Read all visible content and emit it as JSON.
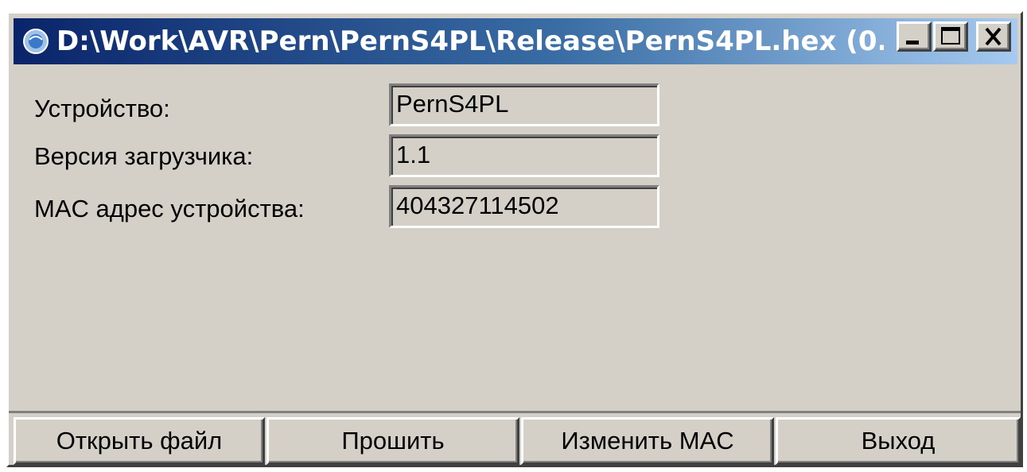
{
  "window": {
    "title": "D:\\Work\\AVR\\Pern\\PernS4PL\\Release\\PernS4PL.hex (0...",
    "icon": "app-globe-icon",
    "caption_buttons": [
      "minimize-icon",
      "maximize-icon",
      "close-icon"
    ]
  },
  "info": {
    "device_label": "Устройство:",
    "device_value": "PernS4PL",
    "bootloader_label": "Версия загрузчика:",
    "bootloader_value": "1.1",
    "mac_label": "MAC адрес устройства:",
    "mac_value": "404327114502"
  },
  "buttons": {
    "open": "Открыть файл",
    "flash": "Прошить",
    "change_mac": "Изменить MAC",
    "exit": "Выход"
  },
  "colors": {
    "face": "#d4d0c8",
    "title_start": "#0a246a",
    "title_end": "#a6caf0"
  }
}
